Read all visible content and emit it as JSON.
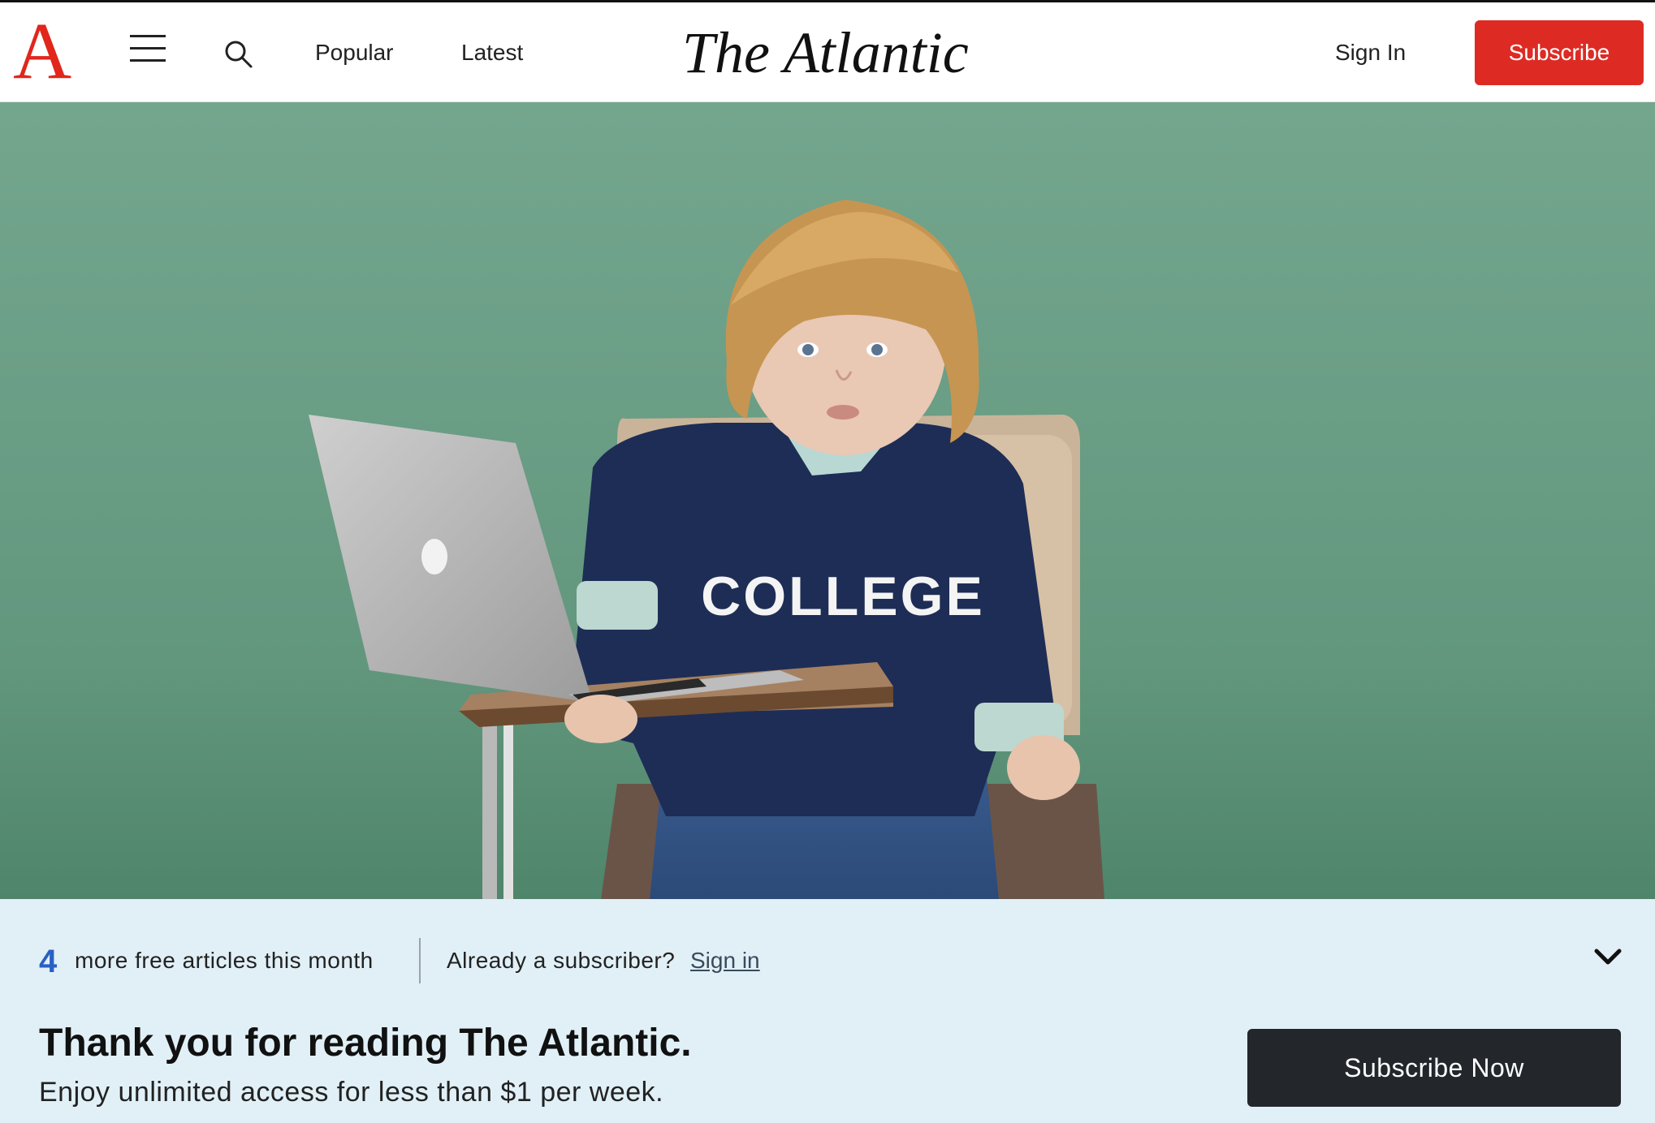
{
  "header": {
    "logo_letter": "A",
    "nav": [
      {
        "label": "Popular"
      },
      {
        "label": "Latest"
      }
    ],
    "masthead": "The Atlantic",
    "sign_in_label": "Sign In",
    "subscribe_label": "Subscribe"
  },
  "hero": {
    "sweater_text": "COLLEGE"
  },
  "paywall": {
    "remaining_count": "4",
    "remaining_text": "more free articles this month",
    "already_subscriber_text": "Already a subscriber?",
    "sign_in_link": "Sign in",
    "heading": "Thank you for reading The Atlantic.",
    "subheading": "Enjoy unlimited access for less than $1 per week.",
    "cta_label": "Subscribe Now"
  },
  "colors": {
    "brand_red": "#dd2b24",
    "paywall_bg": "#e1f0f7",
    "count_blue": "#2a60c4",
    "cta_dark": "#23272b",
    "hero_bg": "#6a9f88"
  },
  "icons": {
    "menu": "hamburger-menu-icon",
    "search": "search-icon",
    "collapse": "chevron-down-icon"
  }
}
